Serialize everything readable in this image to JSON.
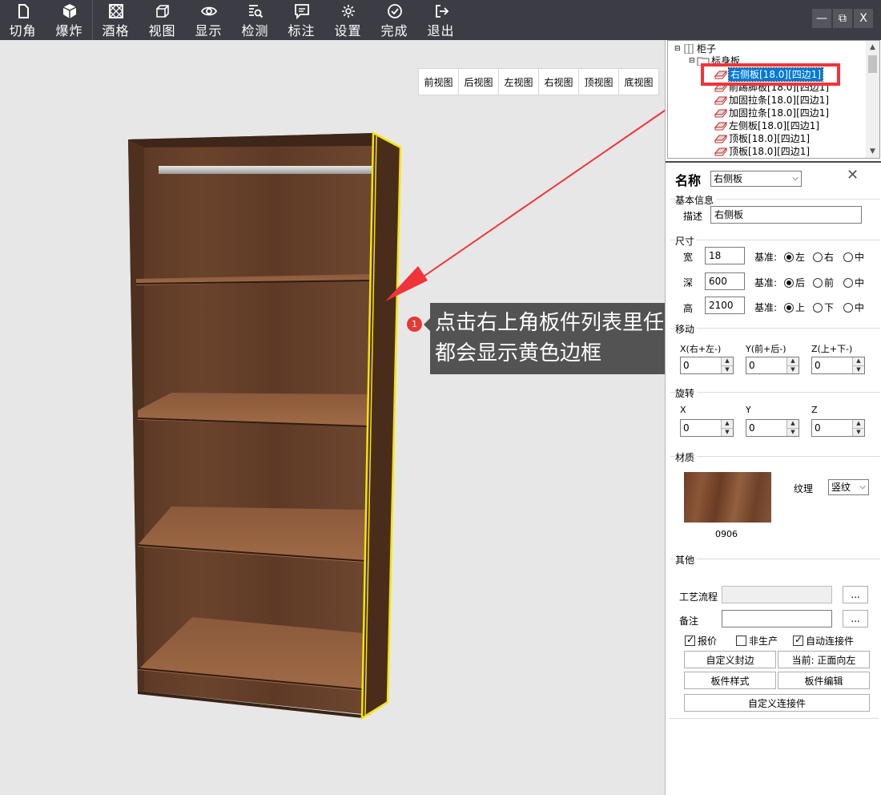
{
  "toolbar": {
    "items": [
      {
        "label": "切角",
        "icon": "file-icon"
      },
      {
        "label": "爆炸",
        "icon": "cube-icon"
      },
      {
        "label": "酒格",
        "icon": "grid-icon"
      },
      {
        "label": "视图",
        "icon": "box-view-icon"
      },
      {
        "label": "显示",
        "icon": "eye-icon"
      },
      {
        "label": "检测",
        "icon": "search-list-icon"
      },
      {
        "label": "标注",
        "icon": "comment-icon"
      },
      {
        "label": "设置",
        "icon": "gear-icon"
      },
      {
        "label": "完成",
        "icon": "check-circle-icon"
      },
      {
        "label": "退出",
        "icon": "exit-icon"
      }
    ],
    "window": {
      "minimize": "—",
      "restore": "⧉",
      "close": "X"
    }
  },
  "viewport": {
    "view_buttons": [
      "前视图",
      "后视图",
      "左视图",
      "右视图",
      "顶视图",
      "底视图"
    ],
    "callout": {
      "number": "1",
      "line1": "点击右上角板件列表里任意一件板",
      "line2": "都会显示黄色边框"
    }
  },
  "tree": {
    "root": "柜子",
    "group": "标身板",
    "items": [
      "右侧板[18.0][四边1]",
      "前踢脚板[18.0][四边1]",
      "加固拉条[18.0][四边1]",
      "加固拉条[18.0][四边1]",
      "左侧板[18.0][四边1]",
      "顶板[18.0][四边1]",
      "顶板[18.0][四边1]"
    ],
    "selected_index": 0
  },
  "props": {
    "name_label": "名称",
    "name_value": "右侧板",
    "close": "✕",
    "basic": {
      "title": "基本信息",
      "desc_label": "描述",
      "desc_value": "右侧板"
    },
    "size": {
      "title": "尺寸",
      "rows": [
        {
          "label": "宽",
          "value": "18",
          "base": "基准:",
          "opts": [
            "左",
            "右",
            "中"
          ],
          "sel": 0
        },
        {
          "label": "深",
          "value": "600",
          "base": "基准:",
          "opts": [
            "后",
            "前",
            "中"
          ],
          "sel": 0
        },
        {
          "label": "高",
          "value": "2100",
          "base": "基准:",
          "opts": [
            "上",
            "下",
            "中"
          ],
          "sel": 0
        }
      ]
    },
    "move": {
      "title": "移动",
      "labels": [
        "X(右+左-)",
        "Y(前+后-)",
        "Z(上+下-)"
      ],
      "values": [
        "0",
        "0",
        "0"
      ]
    },
    "rotate": {
      "title": "旋转",
      "labels": [
        "X",
        "Y",
        "Z"
      ],
      "values": [
        "0",
        "0",
        "0"
      ]
    },
    "material": {
      "title": "材质",
      "code": "0906",
      "grain_label": "纹理",
      "grain_value": "竖纹"
    },
    "other": {
      "title": "其他",
      "process_label": "工艺流程",
      "remark_label": "备注",
      "more": "...",
      "checks": [
        {
          "label": "报价",
          "on": true
        },
        {
          "label": "非生产",
          "on": false
        },
        {
          "label": "自动连接件",
          "on": true
        }
      ],
      "buttons": [
        "自定义封边",
        "当前: 正面向左",
        "板件样式",
        "板件编辑",
        "自定义连接件"
      ]
    }
  }
}
